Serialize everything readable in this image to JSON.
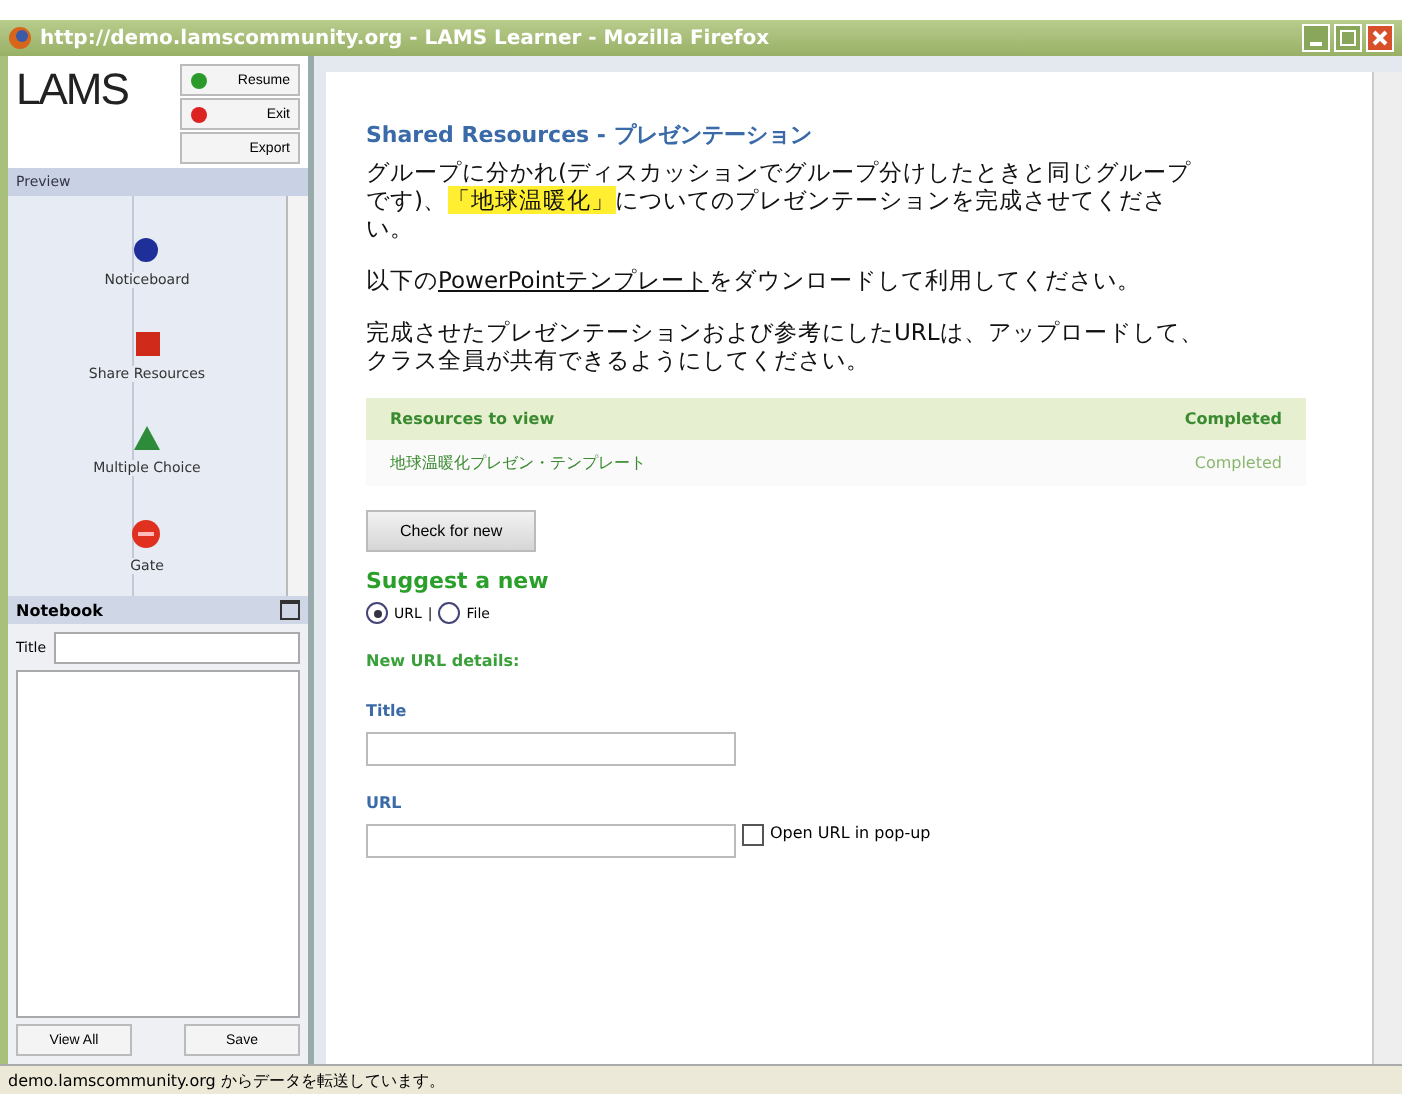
{
  "window": {
    "title": "http://demo.lamscommunity.org - LAMS Learner - Mozilla Firefox"
  },
  "sidebar": {
    "logo": "LAMS",
    "buttons": [
      {
        "label": "Resume",
        "kind": "go"
      },
      {
        "label": "Exit",
        "kind": "stop"
      },
      {
        "label": "Export",
        "kind": "plain"
      }
    ],
    "preview_title": "Preview",
    "activities": [
      {
        "label": "Noticeboard",
        "kind": "circle",
        "color": "#1f2f9a"
      },
      {
        "label": "Share Resources",
        "kind": "square",
        "color": "#d02a1a"
      },
      {
        "label": "Multiple Choice",
        "kind": "triangle",
        "color": "#2e8b3a"
      },
      {
        "label": "Gate",
        "kind": "stop",
        "color": "#e03020"
      }
    ],
    "notebook": {
      "title": "Notebook",
      "title_label": "Title",
      "buttons": [
        "View All",
        "Save"
      ]
    }
  },
  "content": {
    "heading": "Shared Resources - プレゼンテーション",
    "paragraphs": [
      [
        {
          "text": "グループに分かれ(ディスカッションでグループ分けしたときと同じグループです)、",
          "kind": "plain"
        },
        {
          "text": "「地球温暖化」",
          "kind": "highlight"
        },
        {
          "text": "についてのプレゼンテーションを完成させてください。",
          "kind": "plain"
        }
      ],
      [
        {
          "text": "以下の",
          "kind": "plain"
        },
        {
          "text": "PowerPointテンプレート",
          "kind": "link"
        },
        {
          "text": "をダウンロードして利用してください。",
          "kind": "plain"
        }
      ],
      [
        {
          "text": "完成させたプレゼンテーションおよび参考にしたURLは、アップロードして、クラス全員が共有できるようにしてください。",
          "kind": "plain"
        }
      ]
    ],
    "table": {
      "columns": [
        "Resources to view",
        "Completed"
      ],
      "rows": [
        [
          "地球温暖化プレゼン・テンプレート",
          "Completed"
        ]
      ]
    },
    "check_button": "Check for new",
    "suggest_heading": "Suggest a new",
    "option_separator": "|",
    "options": [
      {
        "label": "URL",
        "selected": true
      },
      {
        "label": "File",
        "selected": false
      }
    ],
    "details_heading": "New URL details:",
    "title_label": "Title",
    "url_label": "URL",
    "popup": {
      "label": "Open URL in pop-up",
      "checked": false
    }
  },
  "status_bar": "demo.lamscommunity.org からデータを転送しています。"
}
